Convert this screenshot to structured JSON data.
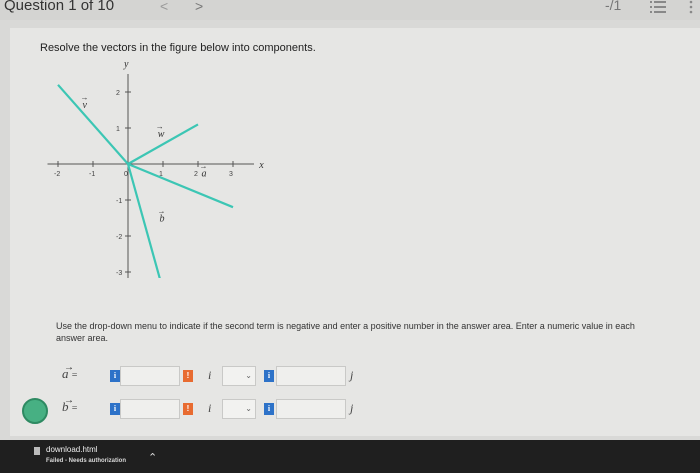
{
  "header": {
    "question_label": "Question 1 of 10",
    "prev_glyph": "<",
    "next_glyph": ">",
    "score": "-/1"
  },
  "question": {
    "prompt": "Resolve the vectors in the figure below into components.",
    "instructions": "Use the drop-down menu to indicate if the second term is negative and enter a positive number in the answer area. Enter a numeric value in each answer area."
  },
  "figure": {
    "x_axis_label": "x",
    "y_axis_label": "y",
    "x_ticks": [
      "-2",
      "-1",
      "0",
      "1",
      "2",
      "3"
    ],
    "y_ticks": [
      "2",
      "1",
      "-1",
      "-2",
      "-3"
    ],
    "vectors": [
      {
        "name": "v",
        "label": "v",
        "from": [
          0,
          0
        ],
        "to": [
          -2,
          2.2
        ]
      },
      {
        "name": "w",
        "label": "w",
        "from": [
          0,
          0
        ],
        "to": [
          2,
          1.1
        ]
      },
      {
        "name": "a",
        "label": "a",
        "from": [
          0,
          0
        ],
        "to": [
          3,
          -1.2
        ]
      },
      {
        "name": "b",
        "label": "b",
        "from": [
          0,
          0
        ],
        "to": [
          1,
          -3.5
        ]
      }
    ],
    "vector_color": "#3cc6b4"
  },
  "answers": [
    {
      "label": "a",
      "equals": "=",
      "info": "i",
      "warn": "!",
      "i_unit": "i",
      "j_unit": "j"
    },
    {
      "label": "b",
      "equals": "=",
      "info": "i",
      "warn": "!",
      "i_unit": "i",
      "j_unit": "j"
    }
  ],
  "download": {
    "filename": "download.html",
    "status": "Failed - Needs authorization"
  },
  "colors": {
    "info_blue": "#2d72c8",
    "warn_orange": "#e86b30",
    "accessibility_green": "#47b083"
  }
}
